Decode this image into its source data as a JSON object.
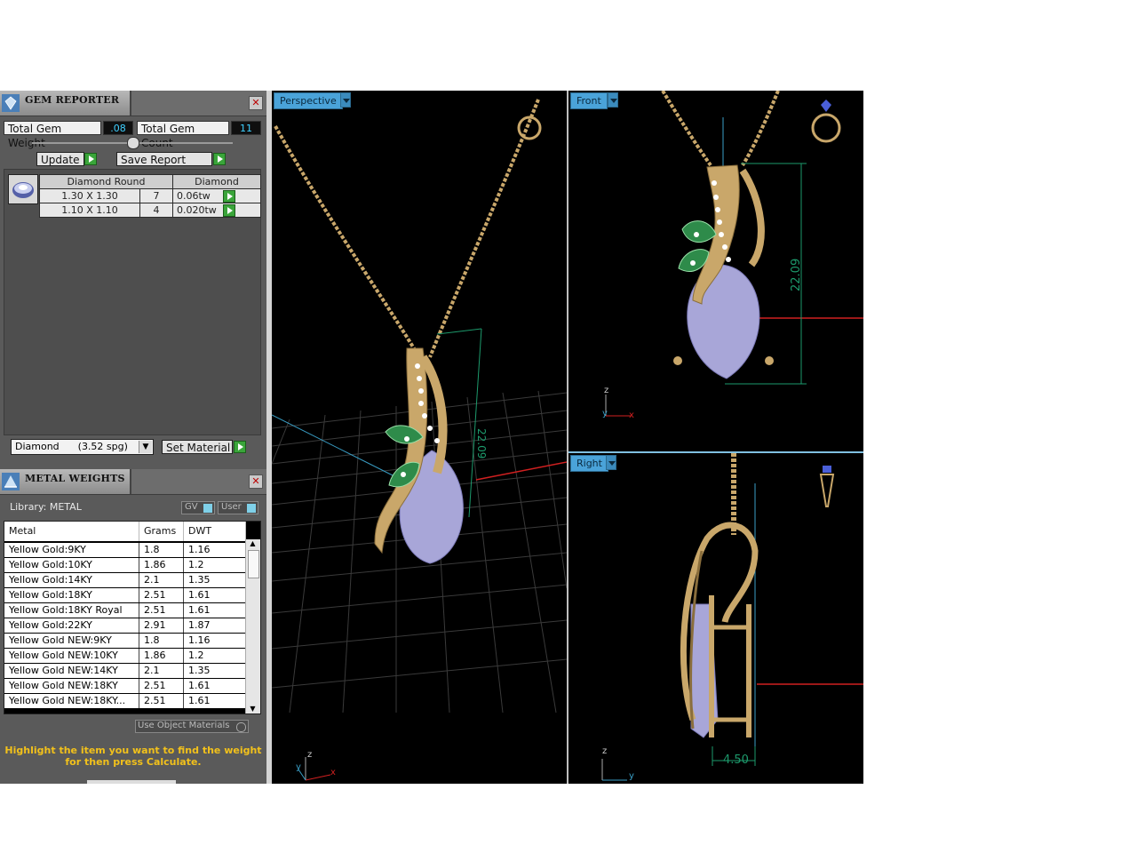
{
  "gem_reporter": {
    "title": "GEM REPORTER",
    "total_gem_weight_label": "Total Gem Weight",
    "total_gem_weight_value": ".08",
    "total_gem_count_label": "Total Gem Count",
    "total_gem_count_value": "11",
    "update_label": "Update",
    "save_report_label": "Save Report",
    "table_headers": [
      "Diamond Round",
      "Diamond"
    ],
    "rows": [
      {
        "size": "1.30 X 1.30",
        "count": "7",
        "weight": "0.06tw"
      },
      {
        "size": "1.10 X 1.10",
        "count": "4",
        "weight": "0.020tw"
      }
    ],
    "material_select": "Diamond      (3.52 spg)",
    "set_material_label": "Set Material"
  },
  "metal_weights": {
    "title": "METAL WEIGHTS",
    "library_label": "Library: METAL",
    "gv_label": "GV",
    "user_label": "User",
    "columns": [
      "Metal",
      "Grams",
      "DWT"
    ],
    "rows": [
      {
        "metal": "Yellow Gold:9KY",
        "grams": "1.8",
        "dwt": "1.16"
      },
      {
        "metal": "Yellow Gold:10KY",
        "grams": "1.86",
        "dwt": "1.2"
      },
      {
        "metal": "Yellow Gold:14KY",
        "grams": "2.1",
        "dwt": "1.35"
      },
      {
        "metal": "Yellow Gold:18KY",
        "grams": "2.51",
        "dwt": "1.61"
      },
      {
        "metal": "Yellow Gold:18KY Royal",
        "grams": "2.51",
        "dwt": "1.61"
      },
      {
        "metal": "Yellow Gold:22KY",
        "grams": "2.91",
        "dwt": "1.87"
      },
      {
        "metal": "Yellow Gold NEW:9KY",
        "grams": "1.8",
        "dwt": "1.16"
      },
      {
        "metal": "Yellow Gold NEW:10KY",
        "grams": "1.86",
        "dwt": "1.2"
      },
      {
        "metal": "Yellow Gold NEW:14KY",
        "grams": "2.1",
        "dwt": "1.35"
      },
      {
        "metal": "Yellow Gold NEW:18KY",
        "grams": "2.51",
        "dwt": "1.61"
      },
      {
        "metal": "Yellow Gold NEW:18KY...",
        "grams": "2.51",
        "dwt": "1.61"
      }
    ],
    "use_object_materials_label": "Use Object Materials",
    "hint_line1": "Highlight the item you want to find the weight",
    "hint_line2": "for then press Calculate."
  },
  "viewports": {
    "perspective": {
      "label": "Perspective",
      "dimension": "22.09"
    },
    "front": {
      "label": "Front",
      "dimension": "22.09"
    },
    "right": {
      "label": "Right",
      "dimension": "4.50"
    }
  },
  "axes": {
    "z": "z",
    "y": "y",
    "x": "x"
  },
  "colors": {
    "gold": "#c9a76a",
    "gem": "#a8a6d8",
    "leaf": "#2e8b4a",
    "dimension": "#1d9a6c",
    "axis_red": "#d02020",
    "viewport_label": "#4aa3d9"
  }
}
